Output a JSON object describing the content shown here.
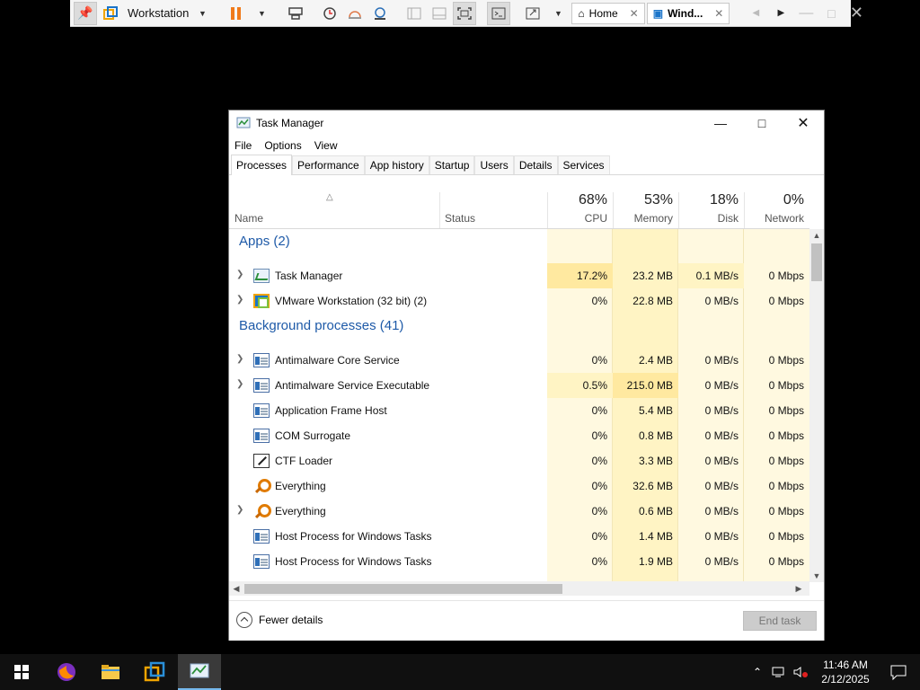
{
  "vmware": {
    "product_label": "Workstation",
    "tabs": [
      {
        "label": "Home"
      },
      {
        "label": "Wind..."
      }
    ]
  },
  "taskmanager": {
    "title": "Task Manager",
    "menu": [
      "File",
      "Options",
      "View"
    ],
    "tabs": [
      "Processes",
      "Performance",
      "App history",
      "Startup",
      "Users",
      "Details",
      "Services"
    ],
    "columns": {
      "name": "Name",
      "status": "Status",
      "cpu": {
        "pct": "68%",
        "label": "CPU"
      },
      "memory": {
        "pct": "53%",
        "label": "Memory"
      },
      "disk": {
        "pct": "18%",
        "label": "Disk"
      },
      "network": {
        "pct": "0%",
        "label": "Network"
      }
    },
    "groups": {
      "apps": "Apps (2)",
      "background": "Background processes (41)"
    },
    "rows": [
      {
        "name": "Task Manager",
        "cpu": "17.2%",
        "memory": "23.2 MB",
        "disk": "0.1 MB/s",
        "network": "0 Mbps"
      },
      {
        "name": "VMware Workstation (32 bit) (2)",
        "cpu": "0%",
        "memory": "22.8 MB",
        "disk": "0 MB/s",
        "network": "0 Mbps"
      },
      {
        "name": "Antimalware Core Service",
        "cpu": "0%",
        "memory": "2.4 MB",
        "disk": "0 MB/s",
        "network": "0 Mbps"
      },
      {
        "name": "Antimalware Service Executable",
        "cpu": "0.5%",
        "memory": "215.0 MB",
        "disk": "0 MB/s",
        "network": "0 Mbps"
      },
      {
        "name": "Application Frame Host",
        "cpu": "0%",
        "memory": "5.4 MB",
        "disk": "0 MB/s",
        "network": "0 Mbps"
      },
      {
        "name": "COM Surrogate",
        "cpu": "0%",
        "memory": "0.8 MB",
        "disk": "0 MB/s",
        "network": "0 Mbps"
      },
      {
        "name": "CTF Loader",
        "cpu": "0%",
        "memory": "3.3 MB",
        "disk": "0 MB/s",
        "network": "0 Mbps"
      },
      {
        "name": "Everything",
        "cpu": "0%",
        "memory": "32.6 MB",
        "disk": "0 MB/s",
        "network": "0 Mbps"
      },
      {
        "name": "Everything",
        "cpu": "0%",
        "memory": "0.6 MB",
        "disk": "0 MB/s",
        "network": "0 Mbps"
      },
      {
        "name": "Host Process for Windows Tasks",
        "cpu": "0%",
        "memory": "1.4 MB",
        "disk": "0 MB/s",
        "network": "0 Mbps"
      },
      {
        "name": "Host Process for Windows Tasks",
        "cpu": "0%",
        "memory": "1.9 MB",
        "disk": "0 MB/s",
        "network": "0 Mbps"
      }
    ],
    "footer": {
      "fewer_details": "Fewer details",
      "end_task": "End task"
    }
  },
  "taskbar": {
    "time": "11:46 AM",
    "date": "2/12/2025"
  },
  "colors": {
    "heat_light": "#fff9e0",
    "heat_mid": "#fff4c4",
    "heat_strong": "#ffe9a0",
    "group_blue": "#1e5aa8"
  }
}
